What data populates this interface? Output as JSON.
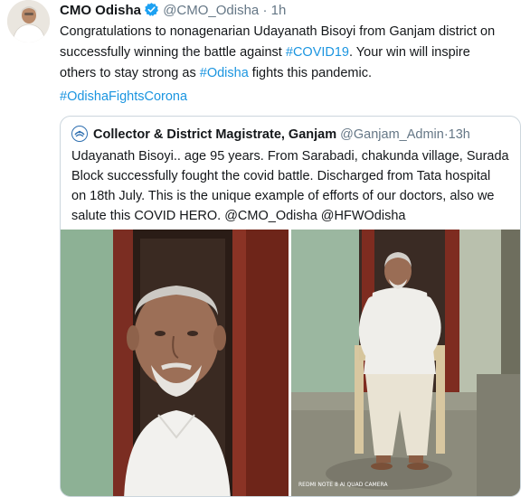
{
  "tweet": {
    "author_name": "CMO Odisha",
    "author_handle": "@CMO_Odisha",
    "separator": "·",
    "time": "1h",
    "text_line1": "Congratulations to nonagenarian Udayanath Bisoyi  from Ganjam district on",
    "text_line2_pre": "successfully winning the battle against ",
    "hashtag1": "#COVID19",
    "text_line2_post": ".  Your win will inspire",
    "text_line3_pre": "others to stay strong as ",
    "hashtag2": "#Odisha",
    "text_line3_post": " fights this pandemic.",
    "hashtag3": "#OdishaFightsCorona"
  },
  "quote": {
    "author_name": "Collector & District Magistrate, Ganjam",
    "author_handle": "@Ganjam_Admin",
    "separator": "·",
    "time": "13h",
    "line1": "Udayanath  Bisoyi.. age 95 years. From Sarabadi, chakunda village, Surada",
    "line2": "Block successfully fought the covid battle. Discharged from Tata hospital",
    "line3": "on 18th July. This is the unique example of efforts of our doctors, also we",
    "line4": "salute this COVID HERO. @CMO_Odisha @HFWOdisha",
    "photo_watermark": "REDMI NOTE 8 AI QUAD CAMERA"
  },
  "icons": {
    "verified": "verified-badge-icon",
    "quote_logo": "district-emblem-icon"
  },
  "colors": {
    "link": "#1b95e0",
    "verified": "#1da1f2",
    "border": "#ccd6dd",
    "muted": "#657786"
  }
}
